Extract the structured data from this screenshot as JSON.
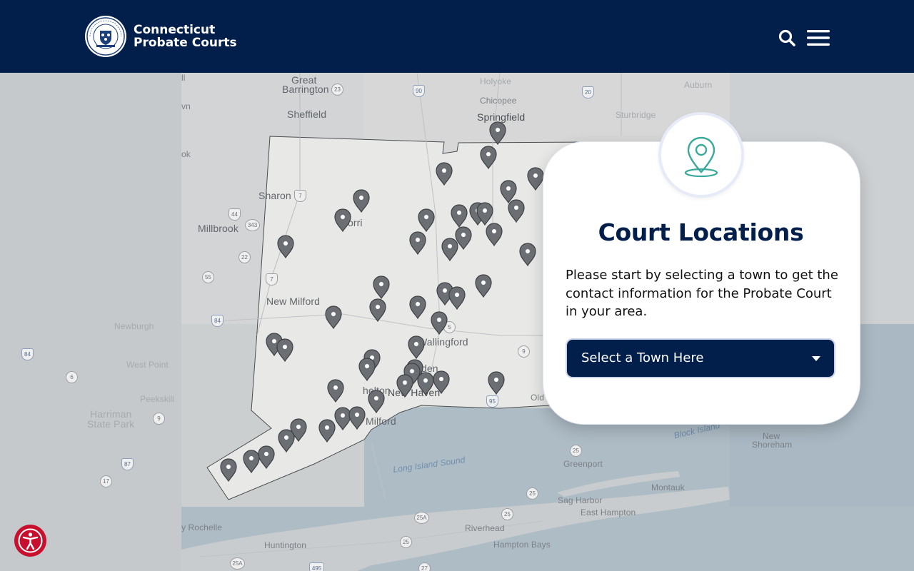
{
  "header": {
    "brand_line1": "Connecticut",
    "brand_line2": "Probate Courts",
    "seal_text_top": "CONNECTICUT",
    "seal_text_bottom": "PROBATE COURTS",
    "search_icon": "search-icon",
    "menu_icon": "hamburger-menu-icon"
  },
  "card": {
    "icon": "map-pin-icon",
    "title": "Court Locations",
    "description": "Please start by selecting a town to get the contact information for the Probate Court in your area.",
    "select_label": "Select a Town Here"
  },
  "map": {
    "labels": {
      "great": "Great",
      "barrington": "Barrington",
      "holyoke": "Holyoke",
      "chicopee": "Chicopee",
      "springfield": "Springfield",
      "sturbridge": "Sturbridge",
      "auburn": "Auburn",
      "sheffield": "Sheffield",
      "sharon": "Sharon",
      "millbrook": "Millbrook",
      "new_milford": "New Milford",
      "newburgh": "Newburgh",
      "west_point": "West Point",
      "peekskill": "Peekskill",
      "harriman": "Harriman",
      "state_park": "State Park",
      "wallingford": "Wallingford",
      "meriden": "den",
      "new_haven": "New Haven",
      "milford": "Milford",
      "shelton": "helton",
      "old": "Old",
      "torrington": "orri",
      "long_island_sound": "Long Island Sound",
      "block_island": "Block Island",
      "new_shoreham_1": "New",
      "new_shoreham_2": "Shoreham",
      "greenport": "Greenport",
      "montauk": "Montauk",
      "sag_harbor": "Sag Harbor",
      "east_hampton": "East Hampton",
      "riverhead": "Riverhead",
      "hampton_bays": "Hampton Bays",
      "huntington": "Huntington",
      "rochelle": "y Rochelle",
      "vn": "vn",
      "ok": "ok",
      "il": "ll"
    },
    "routes": {
      "r23": "23",
      "r90": "90",
      "r7a": "7",
      "r44": "44",
      "r343": "343",
      "r22": "22",
      "r55": "55",
      "r7b": "7",
      "r84": "84",
      "r9": "9",
      "r5": "5",
      "r95": "95",
      "r25a": "25",
      "r25b": "25",
      "r25c": "25",
      "r25A": "25A",
      "r25d": "25",
      "r27": "27",
      "r495": "495",
      "r25A2": "25A",
      "r6": "6",
      "r9w": "9",
      "r87": "87",
      "r17": "17",
      "r84b": "84",
      "r20": "20"
    },
    "pin_count": 50
  },
  "accessibility": {
    "icon": "accessibility-icon"
  },
  "colors": {
    "navy": "#021f4b",
    "teal_pin": "#3aa99a",
    "accessibility_red": "#c8102e",
    "pin_gray": "#6b6f74"
  }
}
